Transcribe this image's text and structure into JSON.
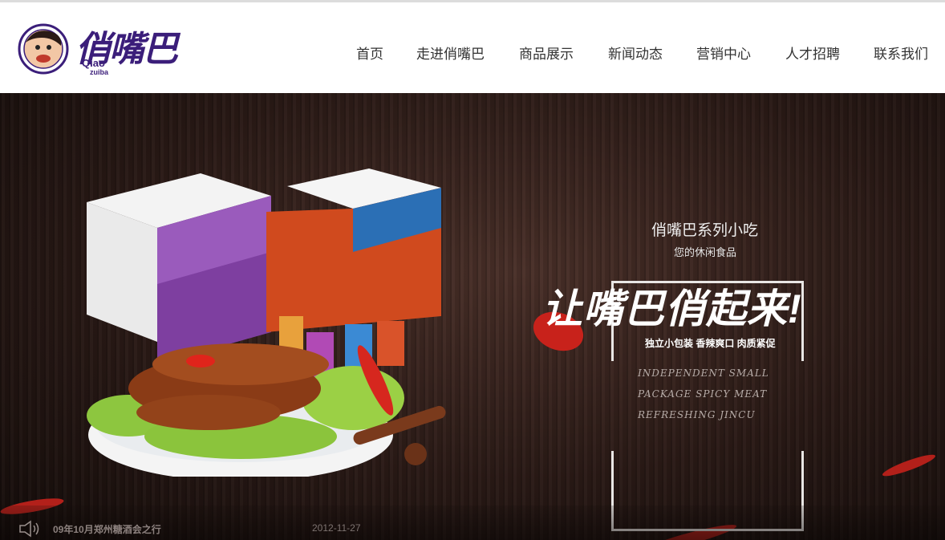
{
  "header": {
    "logo_text": "俏嘴巴",
    "logo_sub1": "Qiao",
    "logo_sub2": "zuiba",
    "nav": [
      {
        "label": "首页"
      },
      {
        "label": "走进俏嘴巴"
      },
      {
        "label": "商品展示"
      },
      {
        "label": "新闻动态"
      },
      {
        "label": "营销中心"
      },
      {
        "label": "人才招聘"
      },
      {
        "label": "联系我们"
      }
    ]
  },
  "banner": {
    "title": "俏嘴巴系列小吃",
    "subtitle": "您的休闲食品",
    "slogan": "让嘴巴俏起来!",
    "features": "独立小包装 香辣爽口 肉质紧促",
    "english": "INDEPENDENT SMALL PACKAGE SPICY MEAT REFRESHING JINCU"
  },
  "news": {
    "headline": "09年10月郑州糖酒会之行",
    "date": "2012-11-27"
  },
  "colors": {
    "brand": "#3b1e7a",
    "nav_text": "#333333"
  }
}
